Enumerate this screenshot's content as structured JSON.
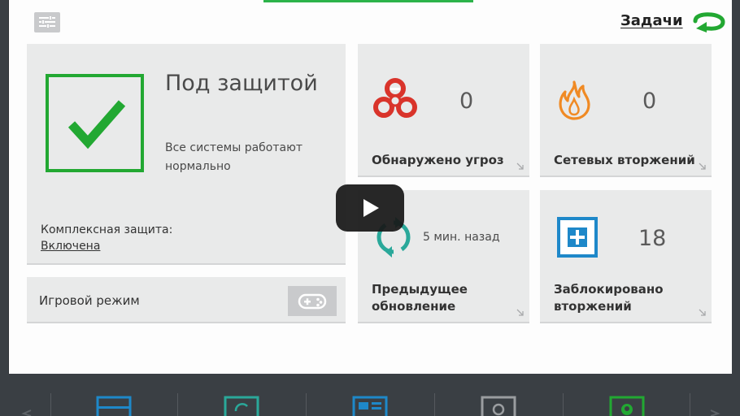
{
  "header": {
    "tasks_label": "Задачи"
  },
  "status": {
    "title": "Под защитой",
    "description": "Все системы работают нормально",
    "protection_label": "Комплексная защита:",
    "protection_value": "Включена"
  },
  "game_mode": {
    "label": "Игровой режим"
  },
  "tiles": {
    "threats": {
      "value": "0",
      "label": "Обнаружено угроз"
    },
    "intrusions": {
      "value": "0",
      "label": "Сетевых вторжений"
    },
    "update": {
      "time": "5 мин. назад",
      "label_line1": "Предыдущее",
      "label_line2": "обновление"
    },
    "blocked": {
      "value": "18",
      "label_line1": "Заблокировано",
      "label_line2": "вторжений"
    }
  },
  "icons": {
    "settings": "sliders-icon",
    "tasks": "return-arrow-icon",
    "threats": "biohazard-icon",
    "intrusions": "flame-icon",
    "update": "refresh-icon",
    "blocked": "plus-box-icon",
    "game": "gamepad-icon",
    "play": "play-icon"
  },
  "colors": {
    "accent_green": "#22a832",
    "threat_red": "#d9342b",
    "flame_orange": "#f08a24",
    "update_teal": "#2aa89a",
    "blocked_blue": "#1e88c9"
  }
}
